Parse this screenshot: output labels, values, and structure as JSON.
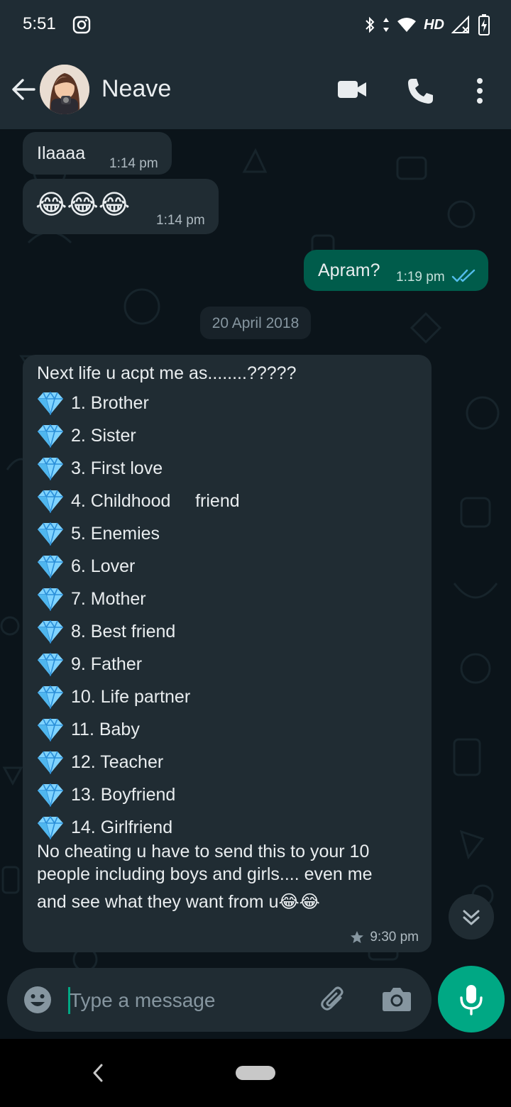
{
  "status_bar": {
    "time": "5:51",
    "network_label": "HD",
    "icons": [
      "instagram-icon",
      "bluetooth-icon",
      "data-arrows-icon",
      "wifi-icon",
      "signal-icon",
      "battery-charging-icon"
    ]
  },
  "header": {
    "contact_name": "Neave",
    "icons": [
      "back-arrow-icon",
      "avatar",
      "video-call-icon",
      "voice-call-icon",
      "more-options-icon"
    ]
  },
  "messages": [
    {
      "direction": "in",
      "text": "Ilaaaa",
      "time": "1:14 pm"
    },
    {
      "direction": "in",
      "text": "😂😂😂",
      "time": "1:14 pm"
    },
    {
      "direction": "out",
      "text": "Apram?",
      "time": "1:19 pm",
      "status": "read"
    }
  ],
  "date_chip": "20 April 2018",
  "long_message": {
    "intro": "Next life u acpt me as........?????",
    "items": [
      "1. Brother",
      "2. Sister",
      "3. First love",
      "4. Childhood     friend",
      "5. Enemies",
      "6. Lover",
      "7. Mother",
      "8. Best friend",
      "9. Father",
      "10. Life partner",
      "11. Baby",
      "12. Teacher",
      "13. Boyfriend",
      "14. Girlfriend"
    ],
    "item_icon": "gem-emoji",
    "outro_lines": [
      "No cheating u have to send this to your 10",
      "people including boys and girls.... even me",
      "and see what they want from u😂😂"
    ],
    "time": "9:30 pm",
    "starred": true
  },
  "composer": {
    "placeholder": "Type a message"
  },
  "colors": {
    "app_bar": "#1f2c34",
    "chat_bg": "#0b141a",
    "incoming": "#202c33",
    "outgoing": "#005c4b",
    "accent": "#00a884",
    "read_ticks": "#53bdeb"
  }
}
